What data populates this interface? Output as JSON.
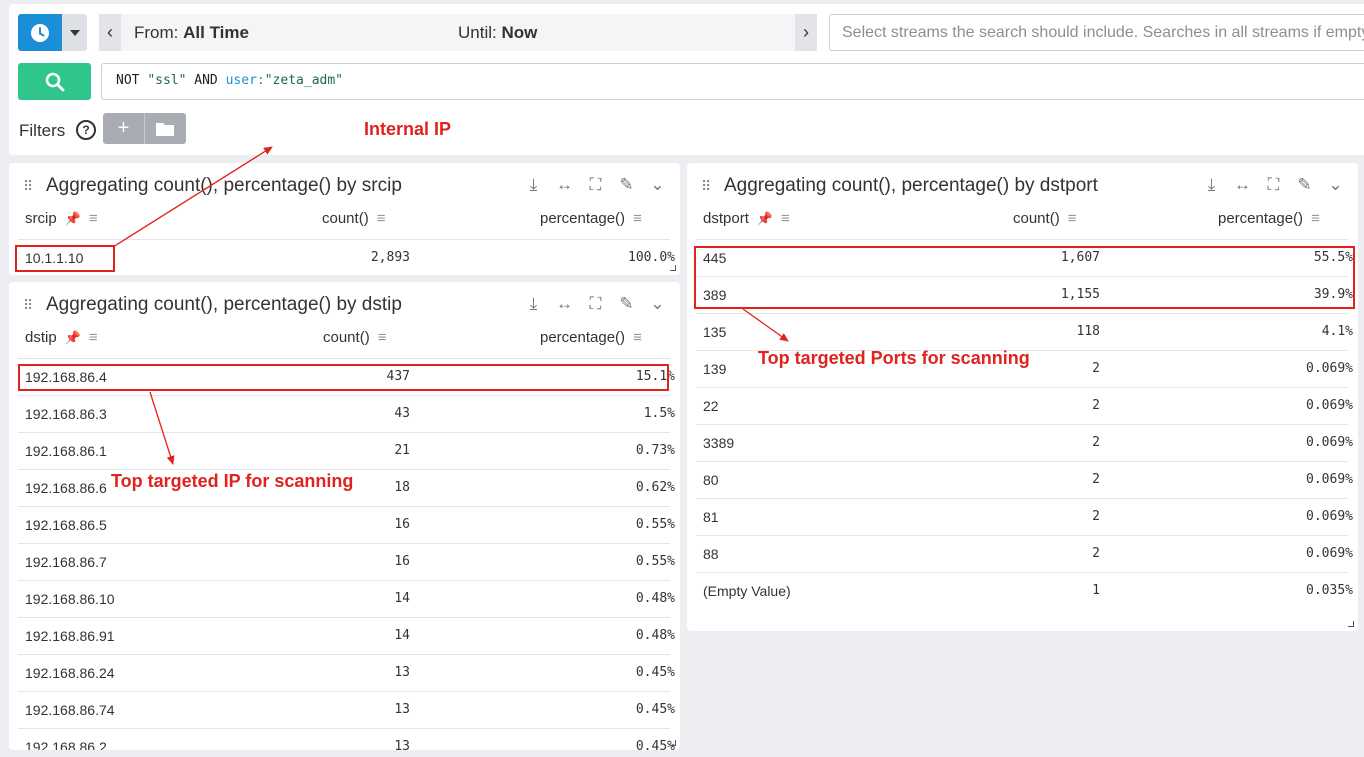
{
  "timebar": {
    "from_label": "From:",
    "from_value": "All Time",
    "until_label": "Until:",
    "until_value": "Now"
  },
  "streams": {
    "placeholder": "Select streams the search should include. Searches in all streams if empty."
  },
  "query": {
    "t1": "NOT ",
    "t2": "\"ssl\"",
    "t3": " AND ",
    "t4": "user:",
    "t5": "\"zeta_adm\""
  },
  "filters": {
    "label": "Filters"
  },
  "widgets": {
    "srcip": {
      "title": "Aggregating count(), percentage() by srcip",
      "columns": [
        "srcip",
        "count()",
        "percentage()"
      ],
      "rows": [
        [
          "10.1.1.10",
          "2,893",
          "100.0%"
        ]
      ]
    },
    "dstip": {
      "title": "Aggregating count(), percentage() by dstip",
      "columns": [
        "dstip",
        "count()",
        "percentage()"
      ],
      "rows": [
        [
          "192.168.86.4",
          "437",
          "15.1%"
        ],
        [
          "192.168.86.3",
          "43",
          "1.5%"
        ],
        [
          "192.168.86.1",
          "21",
          "0.73%"
        ],
        [
          "192.168.86.6",
          "18",
          "0.62%"
        ],
        [
          "192.168.86.5",
          "16",
          "0.55%"
        ],
        [
          "192.168.86.7",
          "16",
          "0.55%"
        ],
        [
          "192.168.86.10",
          "14",
          "0.48%"
        ],
        [
          "192.168.86.91",
          "14",
          "0.48%"
        ],
        [
          "192.168.86.24",
          "13",
          "0.45%"
        ],
        [
          "192.168.86.74",
          "13",
          "0.45%"
        ],
        [
          "192.168.86.2",
          "13",
          "0.45%"
        ]
      ]
    },
    "dstport": {
      "title": "Aggregating count(), percentage() by dstport",
      "columns": [
        "dstport",
        "count()",
        "percentage()"
      ],
      "rows": [
        [
          "445",
          "1,607",
          "55.5%"
        ],
        [
          "389",
          "1,155",
          "39.9%"
        ],
        [
          "135",
          "118",
          "4.1%"
        ],
        [
          "139",
          "2",
          "0.069%"
        ],
        [
          "22",
          "2",
          "0.069%"
        ],
        [
          "3389",
          "2",
          "0.069%"
        ],
        [
          "80",
          "2",
          "0.069%"
        ],
        [
          "81",
          "2",
          "0.069%"
        ],
        [
          "88",
          "2",
          "0.069%"
        ],
        [
          "(Empty Value)",
          "1",
          "0.035%"
        ]
      ]
    }
  },
  "annotations": {
    "internal_ip": "Internal IP",
    "top_ip": "Top targeted IP for scanning",
    "top_ports": "Top targeted Ports for scanning"
  },
  "icons": {
    "clock": "clock-icon",
    "search": "search-icon",
    "download": "download-icon",
    "expand_width": "expand-width-icon",
    "fullscreen": "fullscreen-icon",
    "edit": "edit-icon",
    "chevron": "chevron-down-icon"
  },
  "colors": {
    "brand_blue": "#1a8fd8",
    "search_green": "#2fc68c",
    "annotation_red": "#e0231e"
  }
}
